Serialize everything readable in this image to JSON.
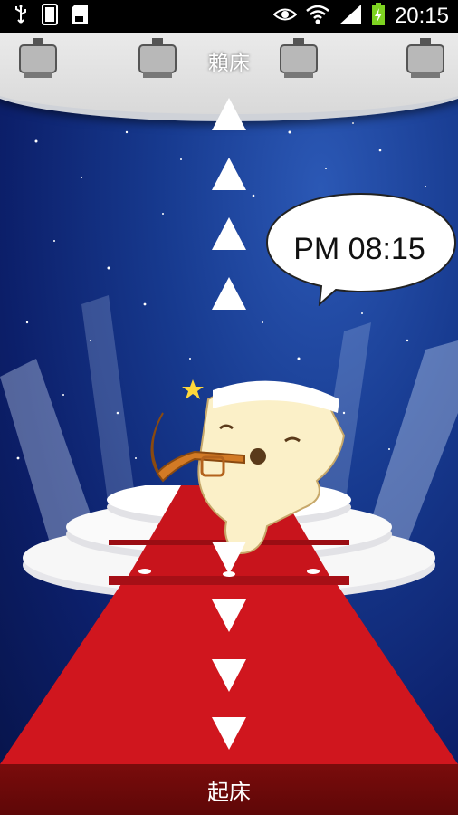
{
  "status_bar": {
    "time": "20:15",
    "icons": [
      "usb-icon",
      "sim-card-icon",
      "sd-card-icon",
      "eye-icon",
      "wifi-icon",
      "signal-icon",
      "battery-charging-icon"
    ]
  },
  "top_target": {
    "label": "賴床"
  },
  "bottom_target": {
    "label": "起床"
  },
  "speech_bubble": {
    "time": "PM 08:15"
  },
  "colors": {
    "carpet": "#c8141c",
    "sky": "#173a8f",
    "stage": "#f0f0f0"
  }
}
